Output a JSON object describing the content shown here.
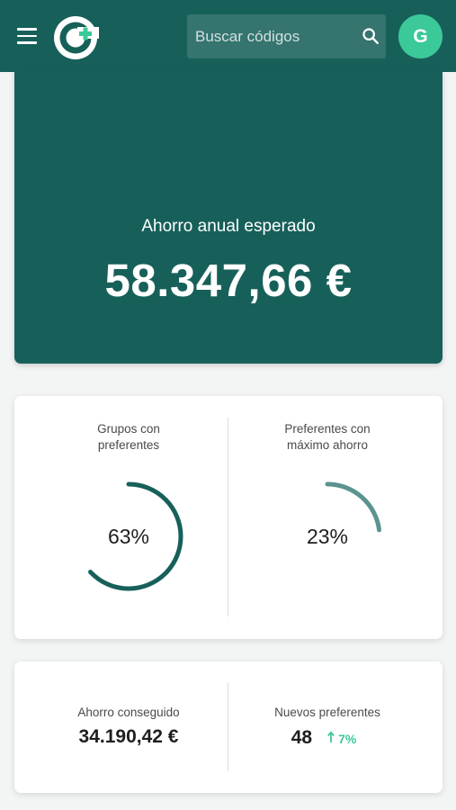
{
  "header": {
    "search": {
      "placeholder": "Buscar códigos",
      "value": ""
    },
    "avatar_initial": "G",
    "colors": {
      "bar": "#17605a",
      "avatar": "#3cc99a"
    }
  },
  "hero": {
    "label": "Ahorro anual esperado",
    "value": "58.347,66 €"
  },
  "gauges": [
    {
      "title_line1": "Grupos con",
      "title_line2": "preferentes",
      "value_text": "63%",
      "fraction": 0.63,
      "color": "#17605a"
    },
    {
      "title_line1": "Preferentes con",
      "title_line2": "máximo ahorro",
      "value_text": "23%",
      "fraction": 0.23,
      "color": "#5b948e"
    }
  ],
  "totals": {
    "saved": {
      "label": "Ahorro conseguido",
      "value": "34.190,42 €"
    },
    "new_preferred": {
      "label": "Nuevos preferentes",
      "value": "48",
      "trend_text": "7%",
      "trend_direction": "up",
      "trend_color": "#3cc99a"
    }
  }
}
